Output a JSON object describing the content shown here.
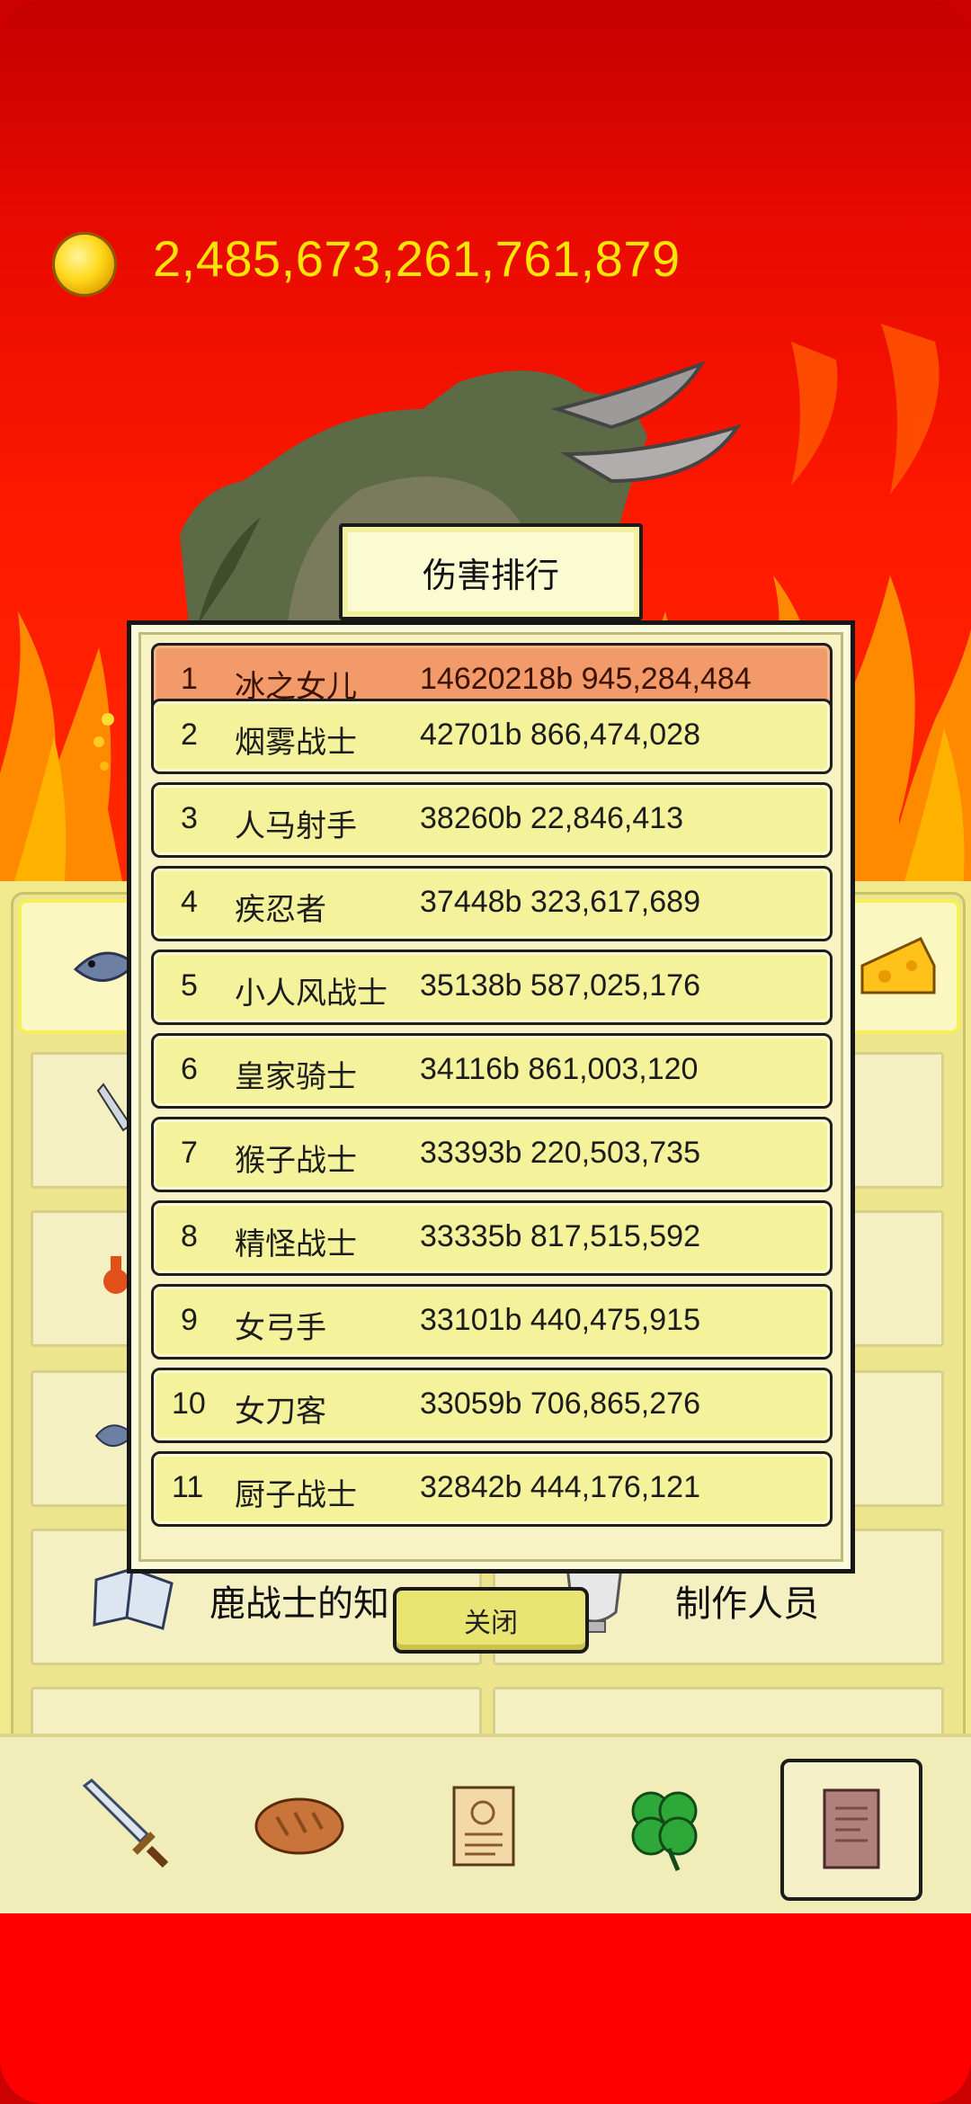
{
  "gold": {
    "amount": "2,485,673,261,761,879"
  },
  "modal": {
    "title": "伤害排行",
    "close_label": "关闭",
    "rows": [
      {
        "rank": "1",
        "name": "冰之女儿",
        "value": "14620218b 945,284,484",
        "highlight": true
      },
      {
        "rank": "2",
        "name": "烟雾战士",
        "value": "42701b 866,474,028"
      },
      {
        "rank": "3",
        "name": "人马射手",
        "value": "38260b 22,846,413"
      },
      {
        "rank": "4",
        "name": "疾忍者",
        "value": "37448b 323,617,689"
      },
      {
        "rank": "5",
        "name": "小人风战士",
        "value": "35138b 587,025,176"
      },
      {
        "rank": "6",
        "name": "皇家骑士",
        "value": "34116b 861,003,120"
      },
      {
        "rank": "7",
        "name": "猴子战士",
        "value": "33393b 220,503,735"
      },
      {
        "rank": "8",
        "name": "精怪战士",
        "value": "33335b 817,515,592"
      },
      {
        "rank": "9",
        "name": "女弓手",
        "value": "33101b 440,475,915"
      },
      {
        "rank": "10",
        "name": "女刀客",
        "value": "33059b 706,865,276"
      },
      {
        "rank": "11",
        "name": "厨子战士",
        "value": "32842b 444,176,121"
      }
    ]
  },
  "panel": {
    "knowledge_label": "鹿战士的知",
    "credits_label": "制作人员"
  },
  "nav": {
    "items": [
      {
        "icon": "sword-icon"
      },
      {
        "icon": "bread-icon"
      },
      {
        "icon": "scroll-icon"
      },
      {
        "icon": "clover-icon"
      },
      {
        "icon": "book-icon",
        "active": true
      }
    ]
  }
}
